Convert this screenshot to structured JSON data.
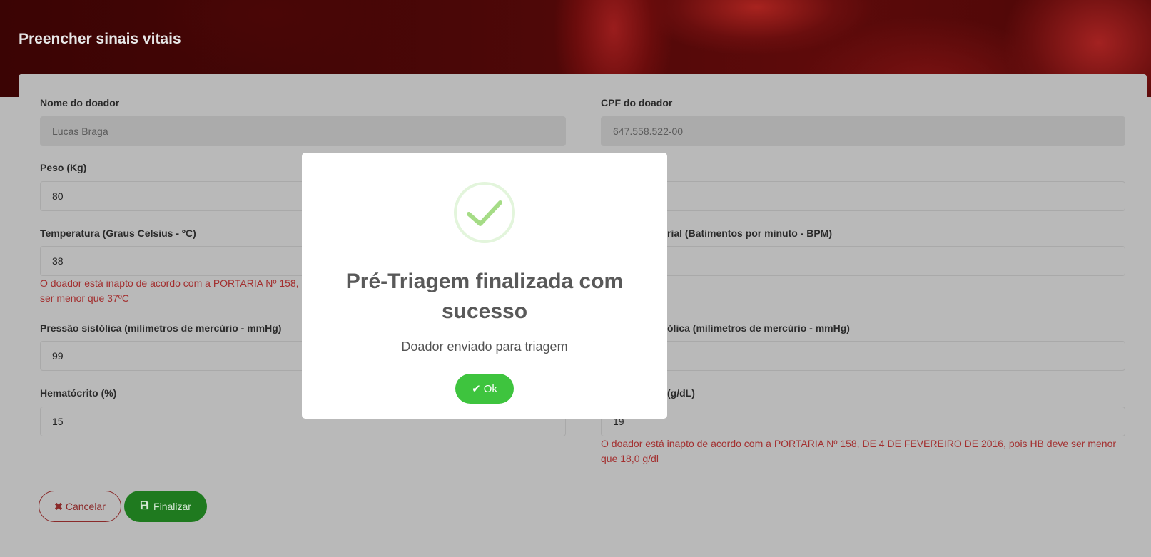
{
  "header": {
    "title": "Preencher sinais vitais"
  },
  "form": {
    "donor_name": {
      "label": "Nome do doador",
      "value": "Lucas Braga"
    },
    "donor_cpf": {
      "label": "CPF do doador",
      "value": "647.558.522-00"
    },
    "weight": {
      "label": "Peso (Kg)",
      "value": "80"
    },
    "right_row2": {
      "value": ""
    },
    "temperature": {
      "label": "Temperatura (Graus Celsius - ºC)",
      "value": "38",
      "error_line1": "O doador está inapto de acordo com a PORTARIA Nº 158,",
      "error_line2": "ser menor que 37ºC"
    },
    "heart_rate": {
      "label": "rial (Batimentos por minuto - BPM)",
      "value": ""
    },
    "systolic": {
      "label": "Pressão sistólica (milímetros de mercúrio - mmHg)",
      "value": "99"
    },
    "diastolic": {
      "label": "ólica (milímetros de mercúrio - mmHg)",
      "value": ""
    },
    "hematocrit": {
      "label": "Hematócrito (%)",
      "value": "15"
    },
    "hemoglobin": {
      "label": "(g/dL)",
      "value": "19",
      "error_line1": "O doador está inapto de acordo com a PORTARIA Nº 158, DE 4 DE FEVEREIRO DE 2016, pois HB deve ser menor",
      "error_line2": "que 18,0 g/dl"
    }
  },
  "actions": {
    "cancel_label": "Cancelar",
    "finish_label": "Finalizar",
    "cancel_icon": "times-icon",
    "finish_icon": "save-icon"
  },
  "modal": {
    "icon": "success-check-icon",
    "title_line1": "Pré-Triagem finalizada com",
    "title_line2": "sucesso",
    "text": "Doador enviado para triagem",
    "ok_label": "Ok",
    "accent_color": "#3ec43e"
  },
  "colors": {
    "error": "#a32f2f",
    "success": "#3ec43e",
    "finish_button": "#1f7a1f"
  }
}
